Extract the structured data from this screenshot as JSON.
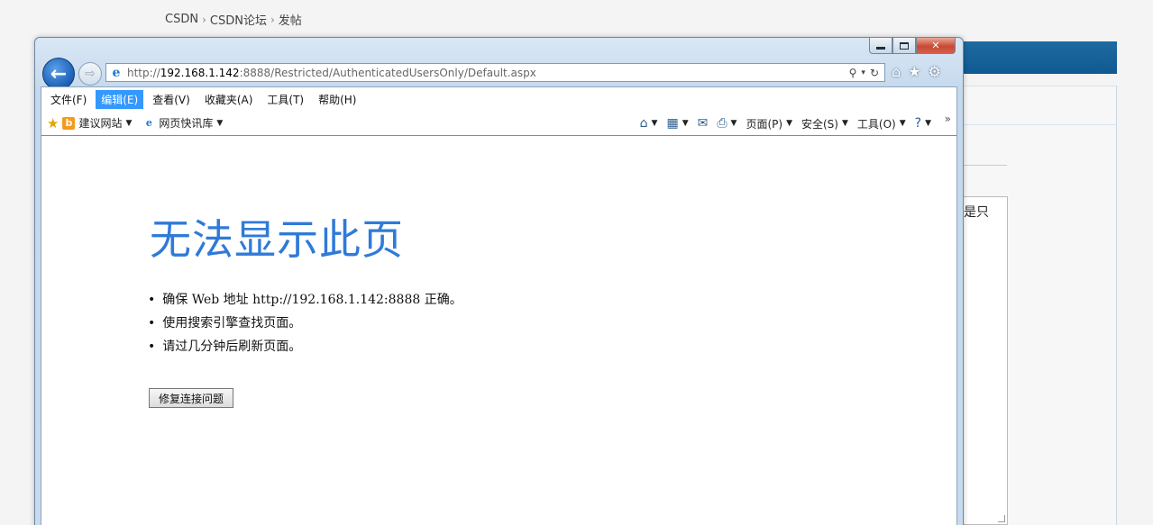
{
  "background": {
    "breadcrumb": [
      "CSDN",
      "CSDN论坛",
      "发帖"
    ],
    "textarea_snippet": "是只"
  },
  "window": {
    "close_glyph": "✕"
  },
  "nav": {
    "url_prefix": "http://",
    "url_host": "192.168.1.142",
    "url_rest": ":8888/Restricted/AuthenticatedUsersOnly/Default.aspx"
  },
  "menu": {
    "items": [
      "文件(F)",
      "编辑(E)",
      "查看(V)",
      "收藏夹(A)",
      "工具(T)",
      "帮助(H)"
    ],
    "active_index": 1
  },
  "favorites": {
    "links": [
      {
        "label": "建议网站",
        "icon": "suggested-sites-icon"
      },
      {
        "label": "网页快讯库",
        "icon": "web-slice-icon"
      }
    ]
  },
  "command_bar": {
    "page": "页面(P)",
    "safety": "安全(S)",
    "tools": "工具(O)"
  },
  "error_page": {
    "title": "无法显示此页",
    "bullets": [
      "确保 Web 地址 http://192.168.1.142:8888 正确。",
      "使用搜索引擎查找页面。",
      "请过几分钟后刷新页面。"
    ],
    "fix_button": "修复连接问题"
  },
  "colors": {
    "accent": "#3399ff",
    "error_title": "#2f7ad8",
    "bg_bar": "#0e5a92"
  }
}
